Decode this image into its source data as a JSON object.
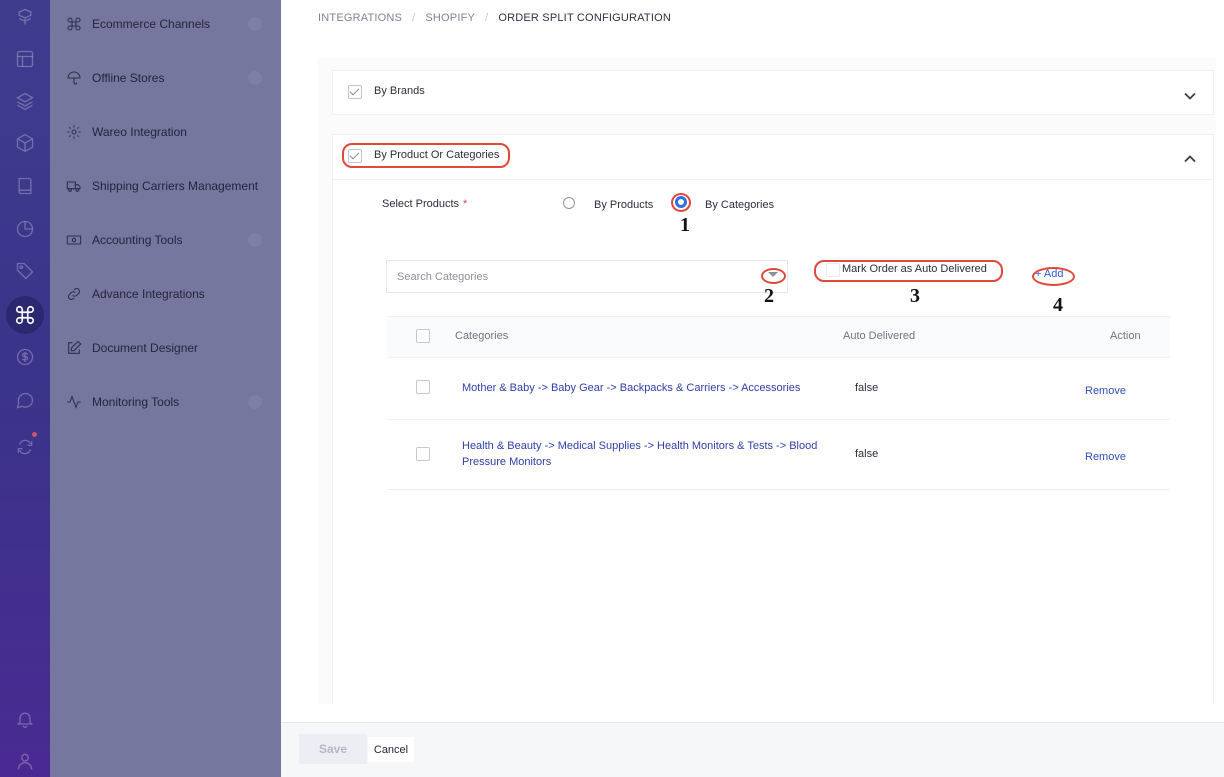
{
  "rail": {
    "icons": [
      "logo-icon",
      "layout-icon",
      "layers-icon",
      "box-icon",
      "book-icon",
      "clock-icon",
      "tag-icon",
      "command-icon",
      "dollar-icon",
      "chat-icon",
      "refresh-icon",
      "bell-icon",
      "user-icon"
    ],
    "active": "command-icon"
  },
  "sidebar": {
    "items": [
      {
        "label": "Ecommerce Channels",
        "icon": "command-icon"
      },
      {
        "label": "Offline Stores",
        "icon": "umbrella-icon"
      },
      {
        "label": "Wareo Integration",
        "icon": "gear-icon"
      },
      {
        "label": "Shipping Carriers Management",
        "icon": "truck-icon"
      },
      {
        "label": "Accounting Tools",
        "icon": "money-icon"
      },
      {
        "label": "Advance Integrations",
        "icon": "link-icon"
      },
      {
        "label": "Document Designer",
        "icon": "edit-icon"
      },
      {
        "label": "Monitoring Tools",
        "icon": "activity-icon"
      }
    ]
  },
  "breadcrumb": {
    "items": [
      "INTEGRATIONS",
      "SHOPIFY",
      "ORDER SPLIT CONFIGURATION"
    ],
    "separator": "/"
  },
  "panels": {
    "brands": {
      "title": "By Brands",
      "checked": true,
      "expanded": false
    },
    "products": {
      "title": "By Product Or Categories",
      "checked": true,
      "expanded": true
    }
  },
  "select_products": {
    "label": "Select Products",
    "required_mark": "*",
    "options": [
      "By Products",
      "By Categories"
    ],
    "selected": "By Categories"
  },
  "search": {
    "placeholder": "Search Categories",
    "value": ""
  },
  "mark_auto_delivered": {
    "label": "Mark Order as Auto Delivered",
    "checked": false
  },
  "add_link": {
    "label": "+ Add"
  },
  "table": {
    "headers": [
      "Categories",
      "Auto Delivered",
      "Action"
    ],
    "rows": [
      {
        "category": "Mother & Baby -> Baby Gear -> Backpacks & Carriers -> Accessories",
        "auto_delivered": "false",
        "action": "Remove"
      },
      {
        "category": "Health & Beauty -> Medical Supplies -> Health Monitors & Tests -> Blood Pressure Monitors",
        "auto_delivered": "false",
        "action": "Remove"
      }
    ]
  },
  "footer": {
    "save_label": "Save",
    "cancel_label": "Cancel"
  },
  "annotations": {
    "labels": [
      "1",
      "2",
      "3",
      "4"
    ],
    "color": "#e0483a"
  }
}
